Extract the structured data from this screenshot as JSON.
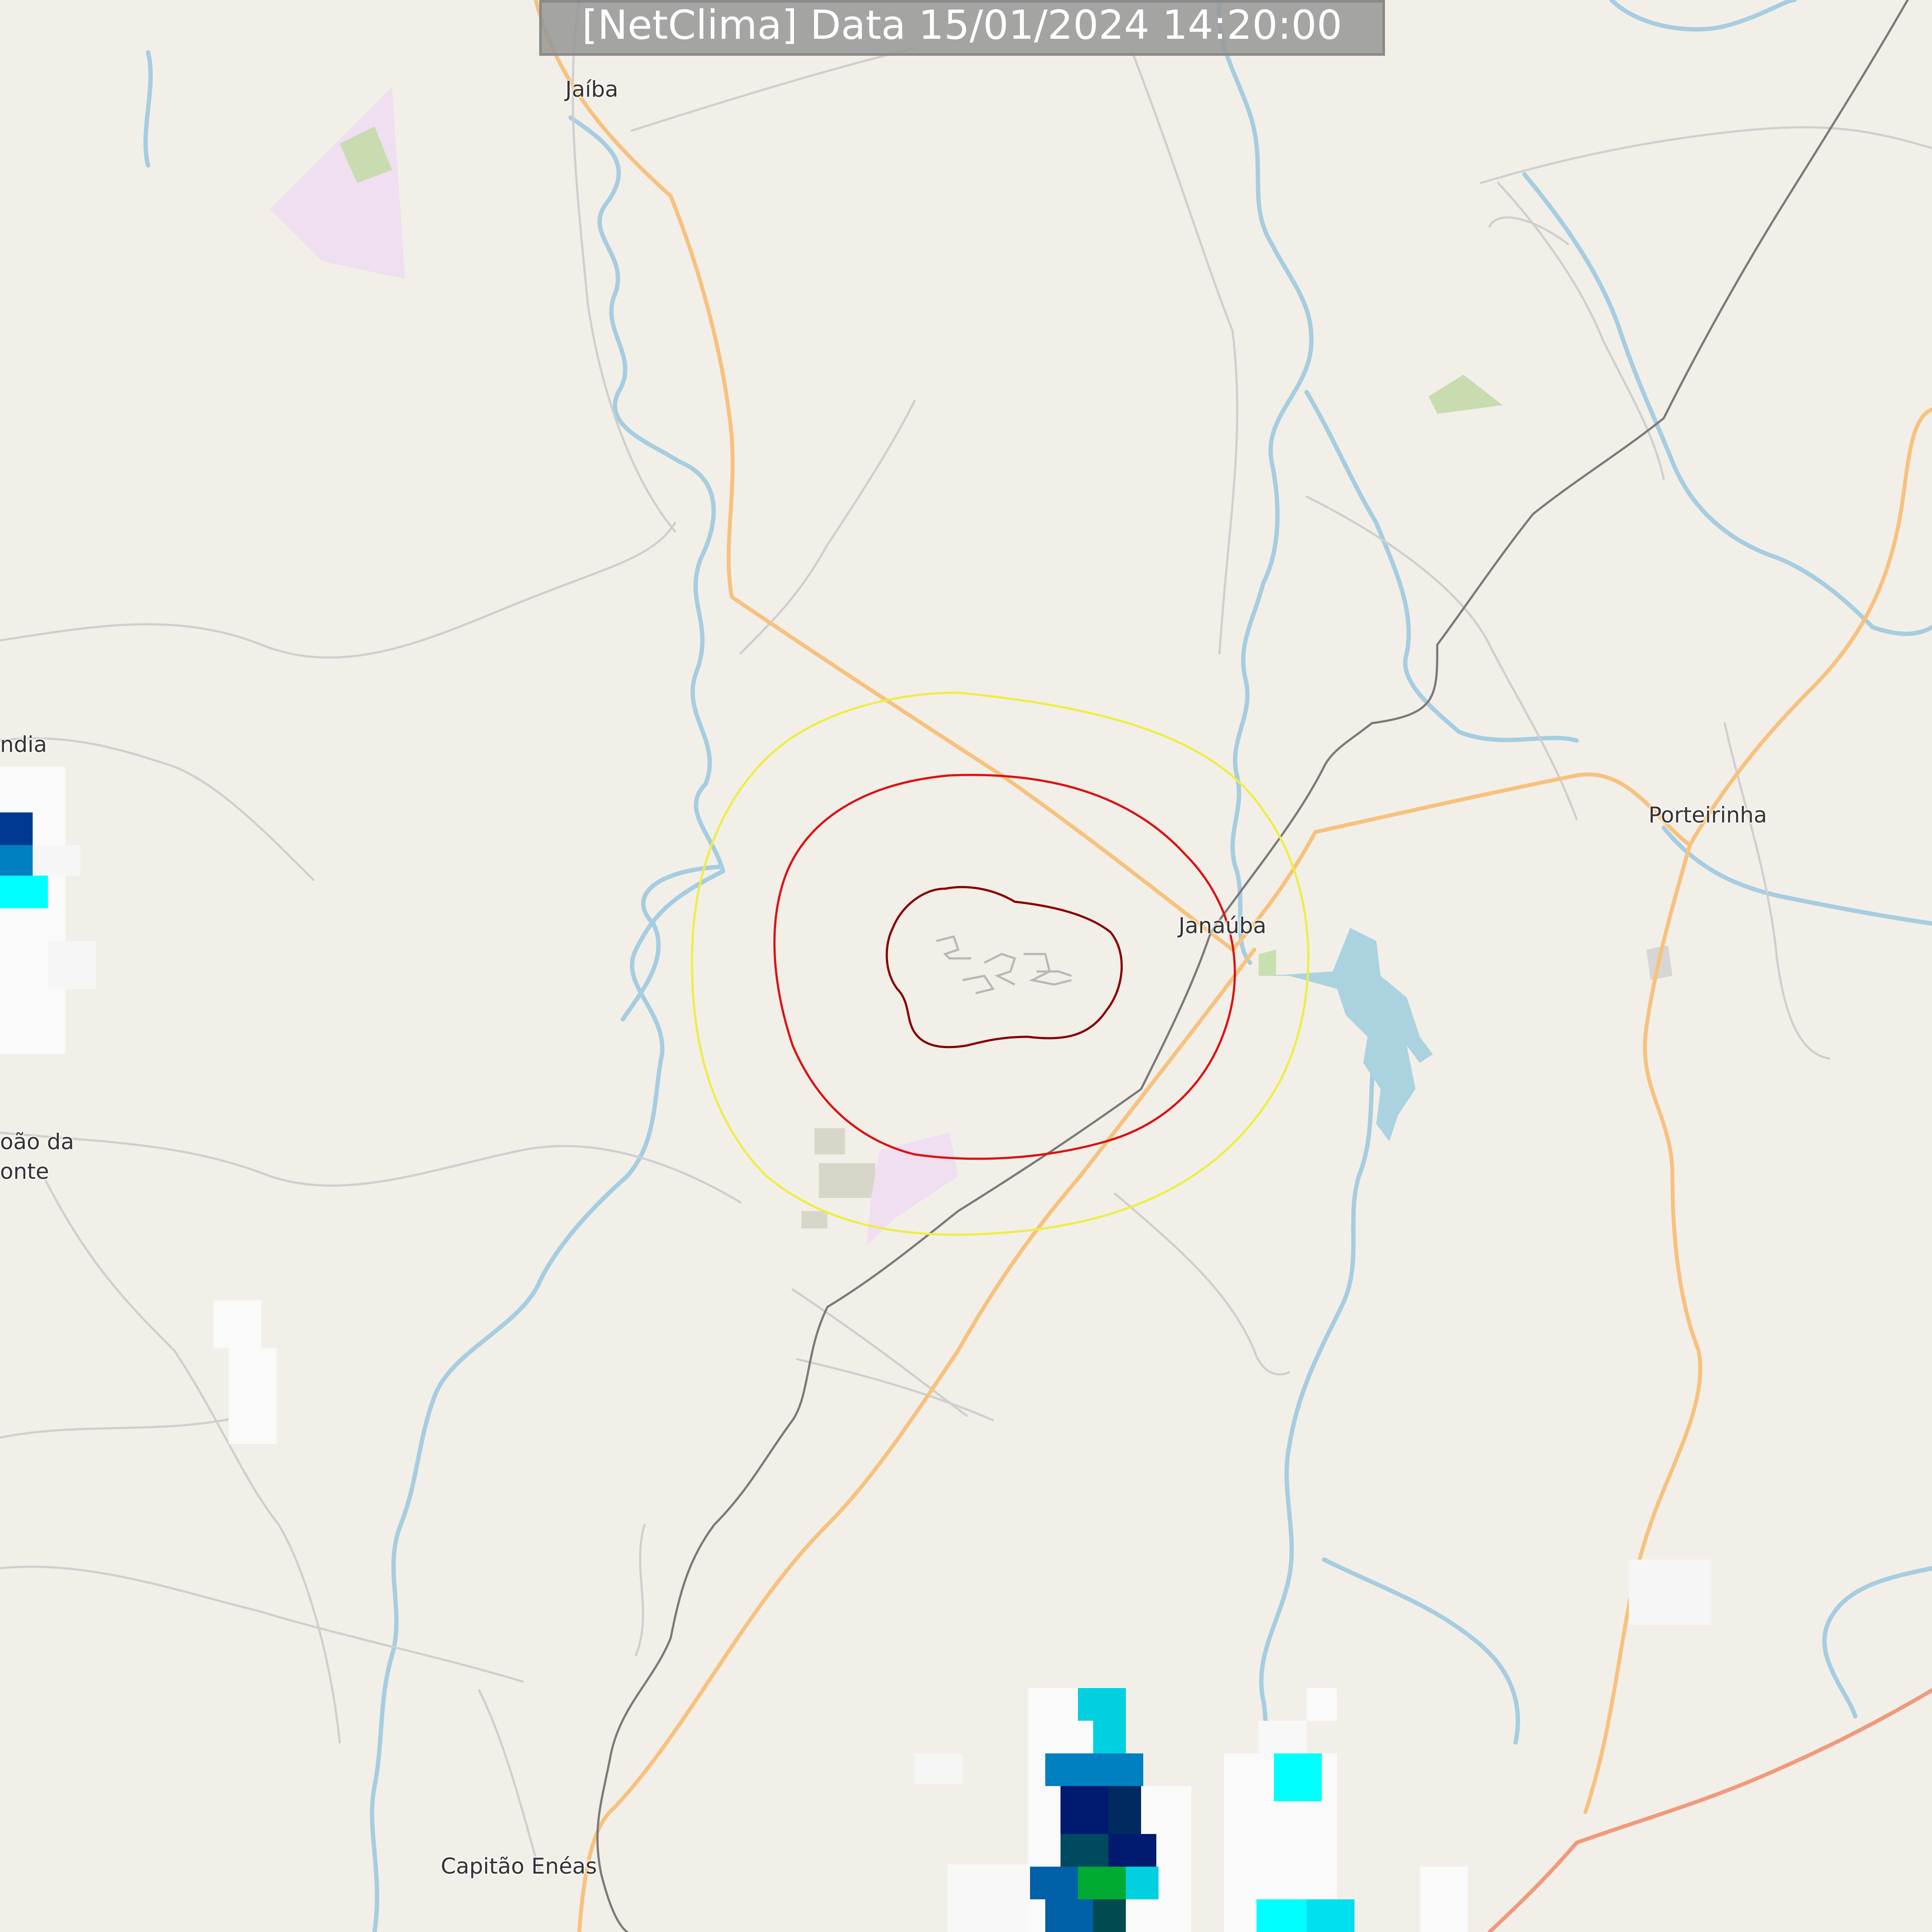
{
  "header": {
    "title": "[NetClima] Data 15/01/2024 14:20:00"
  },
  "places": [
    {
      "id": "jaiba",
      "name": "Jaíba"
    },
    {
      "id": "janauba",
      "name": "Janaúba"
    },
    {
      "id": "porteirinha",
      "name": "Porteirinha"
    },
    {
      "id": "capitao-eneas",
      "name": "Capitão Enéas"
    },
    {
      "id": "indianopolis",
      "name": "ndia"
    },
    {
      "id": "sao-joao-line1",
      "name": "oão da"
    },
    {
      "id": "sao-joao-line2",
      "name": "onte"
    }
  ],
  "colors": {
    "land": "#f2efe9",
    "river": "#a6cde0",
    "lake": "#aad3df",
    "road_primary": "#f7c27e",
    "road_trunk": "#f09a7d",
    "road_minor": "#c8c8c8",
    "railway": "#7a7a7a",
    "ring_outer": "#eeee44",
    "ring_middle": "#dd1111",
    "ring_inner": "#880000",
    "radar_white": "#fafafa",
    "radar_cyan": "#00ffff",
    "radar_lightblue": "#00d0e0",
    "radar_mediumblue": "#0080c0",
    "radar_darkblue": "#003a90",
    "radar_navy": "#001a70",
    "radar_teal": "#004a60",
    "radar_green": "#00aa33",
    "title_bg": "#969696",
    "title_text": "#ffffff"
  }
}
